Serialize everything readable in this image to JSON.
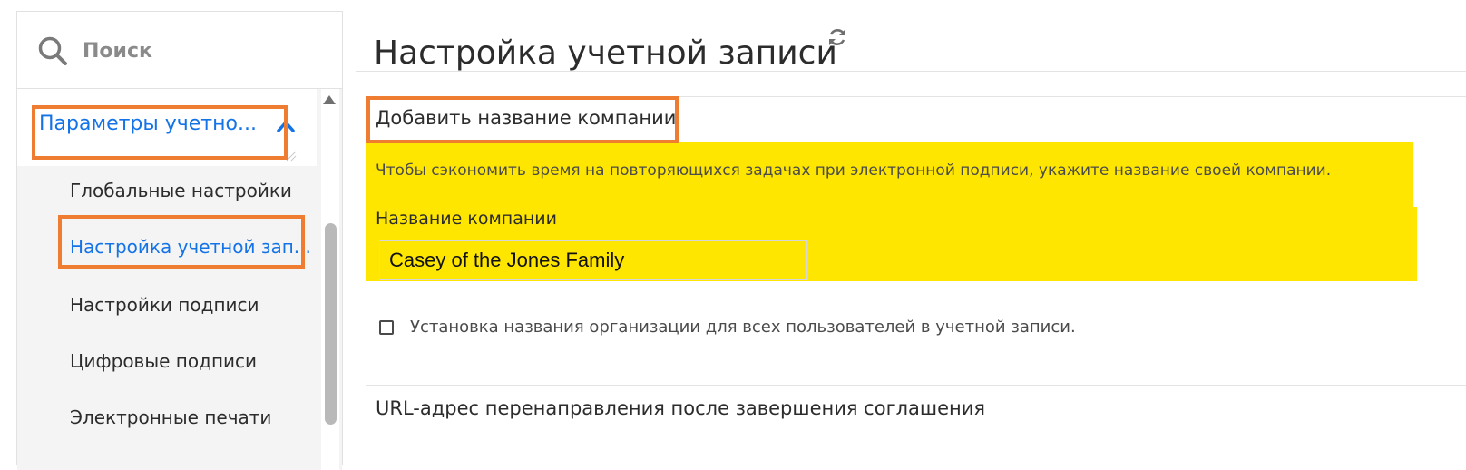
{
  "search": {
    "placeholder": "Поиск",
    "icon": "search-icon"
  },
  "sidebar": {
    "section_title": "Параметры учетно...",
    "items": [
      {
        "label": "Глобальные настройки",
        "active": false
      },
      {
        "label": "Настройка учетной зап...",
        "active": true
      },
      {
        "label": "Настройки подписи",
        "active": false
      },
      {
        "label": "Цифровые подписи",
        "active": false
      },
      {
        "label": "Электронные печати",
        "active": false
      }
    ]
  },
  "main": {
    "page_title": "Настройка учетной записи",
    "company": {
      "heading": "Добавить название компании",
      "description": "Чтобы сэкономить время на повторяющихся задачах при электронной подписи, укажите название своей компании.",
      "field_label": "Название компании",
      "field_value": "Casey of the Jones Family",
      "checkbox_label": "Установка названия организации для всех пользователей в учетной записи.",
      "checkbox_checked": false
    },
    "redirect_heading": "URL-адрес перенаправления после завершения соглашения"
  },
  "colors": {
    "accent": "#1473e6",
    "highlight_border": "#ee7d31",
    "highlight_fill": "#ffe600"
  }
}
